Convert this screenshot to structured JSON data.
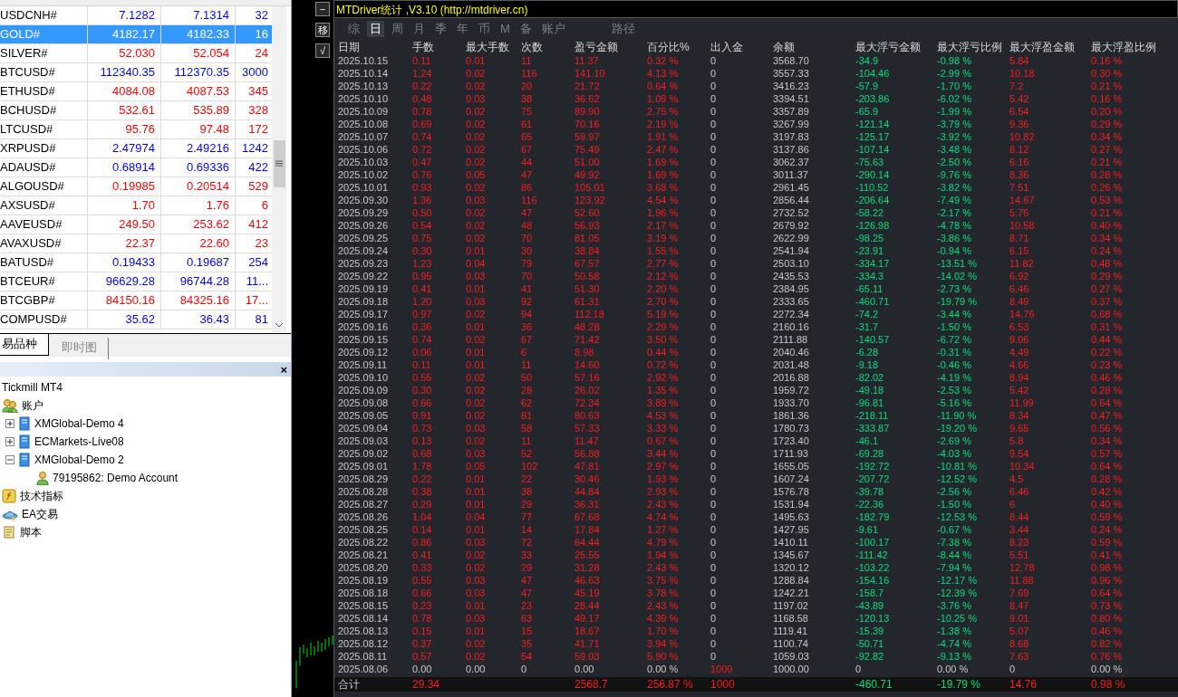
{
  "market_watch": {
    "rows": [
      {
        "symbol": "USDCNH#",
        "bid": "7.1282",
        "ask": "7.1314",
        "spread": "32",
        "color": "#0000ff",
        "selected": false
      },
      {
        "symbol": "GOLD#",
        "bid": "4182.17",
        "ask": "4182.33",
        "spread": "16",
        "selected": true
      },
      {
        "symbol": "SILVER#",
        "bid": "52.030",
        "ask": "52.054",
        "spread": "24",
        "color": "#ff0000",
        "selected": false
      },
      {
        "symbol": "BTCUSD#",
        "bid": "112340.35",
        "ask": "112370.35",
        "spread": "3000",
        "color": "#0000ff",
        "selected": false
      },
      {
        "symbol": "ETHUSD#",
        "bid": "4084.08",
        "ask": "4087.53",
        "spread": "345",
        "color": "#ff0000",
        "selected": false
      },
      {
        "symbol": "BCHUSD#",
        "bid": "532.61",
        "ask": "535.89",
        "spread": "328",
        "color": "#ff0000",
        "selected": false
      },
      {
        "symbol": "LTCUSD#",
        "bid": "95.76",
        "ask": "97.48",
        "spread": "172",
        "color": "#ff0000",
        "selected": false
      },
      {
        "symbol": "XRPUSD#",
        "bid": "2.47974",
        "ask": "2.49216",
        "spread": "1242",
        "color": "#0000ff",
        "selected": false
      },
      {
        "symbol": "ADAUSD#",
        "bid": "0.68914",
        "ask": "0.69336",
        "spread": "422",
        "color": "#0000ff",
        "selected": false
      },
      {
        "symbol": "ALGOUSD#",
        "bid": "0.19985",
        "ask": "0.20514",
        "spread": "529",
        "color": "#ff0000",
        "selected": false
      },
      {
        "symbol": "AXSUSD#",
        "bid": "1.70",
        "ask": "1.76",
        "spread": "6",
        "color": "#ff0000",
        "selected": false
      },
      {
        "symbol": "AAVEUSD#",
        "bid": "249.50",
        "ask": "253.62",
        "spread": "412",
        "color": "#ff0000",
        "selected": false
      },
      {
        "symbol": "AVAXUSD#",
        "bid": "22.37",
        "ask": "22.60",
        "spread": "23",
        "color": "#ff0000",
        "selected": false
      },
      {
        "symbol": "BATUSD#",
        "bid": "0.19433",
        "ask": "0.19687",
        "spread": "254",
        "color": "#0000ff",
        "selected": false
      },
      {
        "symbol": "BTCEUR#",
        "bid": "96629.28",
        "ask": "96744.28",
        "spread": "11...",
        "color": "#0000ff",
        "selected": false
      },
      {
        "symbol": "BTCGBP#",
        "bid": "84150.16",
        "ask": "84325.16",
        "spread": "17...",
        "color": "#ff0000",
        "selected": false
      },
      {
        "symbol": "COMPUSD#",
        "bid": "35.62",
        "ask": "36.43",
        "spread": "81",
        "color": "#0000ff",
        "selected": false
      }
    ],
    "tabs": [
      {
        "label": "易品种",
        "selected": true
      },
      {
        "label": "即时图",
        "selected": false
      }
    ]
  },
  "navigator": {
    "close": "×",
    "tree": [
      {
        "label": "Tickmill MT4",
        "children": [
          {
            "label": "账户",
            "kind": "accounts",
            "children": [
              {
                "label": "XMGlobal-Demo 4",
                "kind": "server",
                "expanded": false
              },
              {
                "label": "ECMarkets-Live08",
                "kind": "server",
                "expanded": false
              },
              {
                "label": "XMGlobal-Demo 2",
                "kind": "server",
                "expanded": true,
                "children": [
                  {
                    "label": "79195862: Demo Account",
                    "kind": "user"
                  }
                ]
              }
            ]
          },
          {
            "label": "技术指标",
            "kind": "indicator"
          },
          {
            "label": "EA交易",
            "kind": "expert"
          },
          {
            "label": "脚本",
            "kind": "script"
          }
        ]
      }
    ]
  },
  "stats": {
    "side_buttons": [
      "−",
      "移",
      "√"
    ],
    "title": "MTDriver统计 ,V3.10 (http://mtdriver.cn)",
    "tabs": [
      {
        "label": "综",
        "selected": false
      },
      {
        "label": "日",
        "selected": true
      },
      {
        "label": "周",
        "selected": false
      },
      {
        "label": "月",
        "selected": false
      },
      {
        "label": "季",
        "selected": false
      },
      {
        "label": "年",
        "selected": false
      },
      {
        "label": "币",
        "selected": false
      },
      {
        "label": "M",
        "selected": false
      },
      {
        "label": "备",
        "selected": false
      },
      {
        "label": "账户",
        "selected": false
      },
      {
        "label": "路径",
        "selected": false
      }
    ],
    "columns": [
      "日期",
      "手数",
      "最大手数",
      "次数",
      "盈亏金额",
      "百分比%",
      "出入金",
      "余额",
      "最大浮亏金额",
      "最大浮亏比例",
      "最大浮盈金额",
      "最大浮盈比例"
    ],
    "rows": [
      {
        "kind": "day",
        "cells": [
          "2025.10.15",
          "0.11",
          "0.01",
          "11",
          "11.37",
          "0.32 %",
          "0",
          "3568.70",
          "-34.9",
          "-0.98 %",
          "5.84",
          "0.16 %"
        ]
      },
      {
        "kind": "day",
        "cells": [
          "2025.10.14",
          "1.24",
          "0.02",
          "116",
          "141.10",
          "4.13 %",
          "0",
          "3557.33",
          "-104.46",
          "-2.99 %",
          "10.18",
          "0.30 %"
        ]
      },
      {
        "kind": "day",
        "cells": [
          "2025.10.13",
          "0.22",
          "0.02",
          "20",
          "21.72",
          "0.64 %",
          "0",
          "3416.23",
          "-57.9",
          "-1.70 %",
          "7.2",
          "0.21 %"
        ]
      },
      {
        "kind": "day",
        "cells": [
          "2025.10.10",
          "0.48",
          "0.03",
          "38",
          "36.62",
          "1.09 %",
          "0",
          "3394.51",
          "-203.86",
          "-6.02 %",
          "5.42",
          "0.16 %"
        ]
      },
      {
        "kind": "day",
        "cells": [
          "2025.10.09",
          "0.78",
          "0.02",
          "75",
          "89.90",
          "2.75 %",
          "0",
          "3357.89",
          "-65.9",
          "-1.99 %",
          "6.54",
          "0.20 %"
        ]
      },
      {
        "kind": "day",
        "cells": [
          "2025.10.08",
          "0.69",
          "0.02",
          "61",
          "70.16",
          "2.19 %",
          "0",
          "3267.99",
          "-121.14",
          "-3.79 %",
          "9.36",
          "0.29 %"
        ]
      },
      {
        "kind": "day",
        "cells": [
          "2025.10.07",
          "0.74",
          "0.02",
          "65",
          "59.97",
          "1.91 %",
          "0",
          "3197.83",
          "-125.17",
          "-3.92 %",
          "10.82",
          "0.34 %"
        ]
      },
      {
        "kind": "day",
        "cells": [
          "2025.10.06",
          "0.72",
          "0.02",
          "67",
          "75.49",
          "2.47 %",
          "0",
          "3137.86",
          "-107.14",
          "-3.48 %",
          "8.12",
          "0.27 %"
        ]
      },
      {
        "kind": "day",
        "cells": [
          "2025.10.03",
          "0.47",
          "0.02",
          "44",
          "51.00",
          "1.69 %",
          "0",
          "3062.37",
          "-75.63",
          "-2.50 %",
          "6.16",
          "0.21 %"
        ]
      },
      {
        "kind": "day",
        "cells": [
          "2025.10.02",
          "0.76",
          "0.05",
          "47",
          "49.92",
          "1.69 %",
          "0",
          "3011.37",
          "-290.14",
          "-9.76 %",
          "8.36",
          "0.28 %"
        ]
      },
      {
        "kind": "day",
        "cells": [
          "2025.10.01",
          "0.93",
          "0.02",
          "86",
          "105.01",
          "3.68 %",
          "0",
          "2961.45",
          "-110.52",
          "-3.82 %",
          "7.51",
          "0.26 %"
        ]
      },
      {
        "kind": "day",
        "cells": [
          "2025.09.30",
          "1.36",
          "0.03",
          "116",
          "123.92",
          "4.54 %",
          "0",
          "2856.44",
          "-206.64",
          "-7.49 %",
          "14.67",
          "0.53 %"
        ]
      },
      {
        "kind": "day",
        "cells": [
          "2025.09.29",
          "0.50",
          "0.02",
          "47",
          "52.60",
          "1.96 %",
          "0",
          "2732.52",
          "-58.22",
          "-2.17 %",
          "5.76",
          "0.21 %"
        ]
      },
      {
        "kind": "day",
        "cells": [
          "2025.09.26",
          "0.54",
          "0.02",
          "48",
          "56.93",
          "2.17 %",
          "0",
          "2679.92",
          "-126.98",
          "-4.78 %",
          "10.58",
          "0.40 %"
        ]
      },
      {
        "kind": "day",
        "cells": [
          "2025.09.25",
          "0.75",
          "0.02",
          "70",
          "81.05",
          "3.19 %",
          "0",
          "2622.99",
          "-98.25",
          "-3.86 %",
          "8.71",
          "0.34 %"
        ]
      },
      {
        "kind": "day",
        "cells": [
          "2025.09.24",
          "0.30",
          "0.01",
          "30",
          "38.84",
          "1.55 %",
          "0",
          "2541.94",
          "-23.91",
          "-0.94 %",
          "6.15",
          "0.24 %"
        ]
      },
      {
        "kind": "day",
        "cells": [
          "2025.09.23",
          "1.23",
          "0.04",
          "79",
          "67.57",
          "2.77 %",
          "0",
          "2503.10",
          "-334.17",
          "-13.51 %",
          "11.82",
          "0.48 %"
        ]
      },
      {
        "kind": "day",
        "cells": [
          "2025.09.22",
          "0.95",
          "0.03",
          "70",
          "50.58",
          "2.12 %",
          "0",
          "2435.53",
          "-334.3",
          "-14.02 %",
          "6.92",
          "0.29 %"
        ]
      },
      {
        "kind": "day",
        "cells": [
          "2025.09.19",
          "0.41",
          "0.01",
          "41",
          "51.30",
          "2.20 %",
          "0",
          "2384.95",
          "-65.11",
          "-2.73 %",
          "6.46",
          "0.27 %"
        ]
      },
      {
        "kind": "day",
        "cells": [
          "2025.09.18",
          "1.20",
          "0.03",
          "92",
          "61.31",
          "2.70 %",
          "0",
          "2333.65",
          "-460.71",
          "-19.79 %",
          "8.49",
          "0.37 %"
        ]
      },
      {
        "kind": "day",
        "cells": [
          "2025.09.17",
          "0.97",
          "0.02",
          "94",
          "112.18",
          "5.19 %",
          "0",
          "2272.34",
          "-74.2",
          "-3.44 %",
          "14.76",
          "0.68 %"
        ]
      },
      {
        "kind": "day",
        "cells": [
          "2025.09.16",
          "0.36",
          "0.01",
          "36",
          "48.28",
          "2.29 %",
          "0",
          "2160.16",
          "-31.7",
          "-1.50 %",
          "6.53",
          "0.31 %"
        ]
      },
      {
        "kind": "day",
        "cells": [
          "2025.09.15",
          "0.74",
          "0.02",
          "67",
          "71.42",
          "3.50 %",
          "0",
          "2111.88",
          "-140.57",
          "-6.72 %",
          "9.06",
          "0.44 %"
        ]
      },
      {
        "kind": "day",
        "cells": [
          "2025.09.12",
          "0.06",
          "0.01",
          "6",
          "8.98",
          "0.44 %",
          "0",
          "2040.46",
          "-6.28",
          "-0.31 %",
          "4.49",
          "0.22 %"
        ]
      },
      {
        "kind": "day",
        "cells": [
          "2025.09.11",
          "0.11",
          "0.01",
          "11",
          "14.60",
          "0.72 %",
          "0",
          "2031.48",
          "-9.18",
          "-0.46 %",
          "4.66",
          "0.23 %"
        ]
      },
      {
        "kind": "day",
        "cells": [
          "2025.09.10",
          "0.55",
          "0.02",
          "50",
          "57.16",
          "2.92 %",
          "0",
          "2016.88",
          "-82.02",
          "-4.19 %",
          "8.94",
          "0.46 %"
        ]
      },
      {
        "kind": "day",
        "cells": [
          "2025.09.09",
          "0.30",
          "0.02",
          "28",
          "26.02",
          "1.35 %",
          "0",
          "1959.72",
          "-49.18",
          "-2.53 %",
          "5.42",
          "0.28 %"
        ]
      },
      {
        "kind": "day",
        "cells": [
          "2025.09.08",
          "0.66",
          "0.02",
          "62",
          "72.34",
          "3.89 %",
          "0",
          "1933.70",
          "-96.81",
          "-5.16 %",
          "11.99",
          "0.64 %"
        ]
      },
      {
        "kind": "day",
        "cells": [
          "2025.09.05",
          "0.91",
          "0.02",
          "81",
          "80.63",
          "4.53 %",
          "0",
          "1861.36",
          "-218.11",
          "-11.90 %",
          "8.34",
          "0.47 %"
        ]
      },
      {
        "kind": "day",
        "cells": [
          "2025.09.04",
          "0.73",
          "0.03",
          "58",
          "57.33",
          "3.33 %",
          "0",
          "1780.73",
          "-333.87",
          "-19.20 %",
          "9.65",
          "0.56 %"
        ]
      },
      {
        "kind": "day",
        "cells": [
          "2025.09.03",
          "0.13",
          "0.02",
          "11",
          "11.47",
          "0.67 %",
          "0",
          "1723.40",
          "-46.1",
          "-2.69 %",
          "5.8",
          "0.34 %"
        ]
      },
      {
        "kind": "day",
        "cells": [
          "2025.09.02",
          "0.68",
          "0.03",
          "52",
          "56.88",
          "3.44 %",
          "0",
          "1711.93",
          "-69.28",
          "-4.03 %",
          "9.54",
          "0.57 %"
        ]
      },
      {
        "kind": "day",
        "cells": [
          "2025.09.01",
          "1.78",
          "0.05",
          "102",
          "47.81",
          "2.97 %",
          "0",
          "1655.05",
          "-192.72",
          "-10.81 %",
          "10.34",
          "0.64 %"
        ]
      },
      {
        "kind": "day",
        "cells": [
          "2025.08.29",
          "0.22",
          "0.01",
          "22",
          "30.46",
          "1.93 %",
          "0",
          "1607.24",
          "-207.72",
          "-12.52 %",
          "4.5",
          "0.28 %"
        ]
      },
      {
        "kind": "day",
        "cells": [
          "2025.08.28",
          "0.38",
          "0.01",
          "38",
          "44.84",
          "2.93 %",
          "0",
          "1576.78",
          "-39.78",
          "-2.56 %",
          "6.46",
          "0.42 %"
        ]
      },
      {
        "kind": "day",
        "cells": [
          "2025.08.27",
          "0.29",
          "0.01",
          "29",
          "36.31",
          "2.43 %",
          "0",
          "1531.94",
          "-22.36",
          "-1.50 %",
          "6",
          "0.40 %"
        ]
      },
      {
        "kind": "day",
        "cells": [
          "2025.08.26",
          "1.04",
          "0.04",
          "77",
          "67.68",
          "4.74 %",
          "0",
          "1495.63",
          "-182.79",
          "-12.53 %",
          "8.44",
          "0.59 %"
        ]
      },
      {
        "kind": "day",
        "cells": [
          "2025.08.25",
          "0.14",
          "0.01",
          "14",
          "17.84",
          "1.27 %",
          "0",
          "1427.95",
          "-9.61",
          "-0.67 %",
          "3.44",
          "0.24 %"
        ]
      },
      {
        "kind": "day",
        "cells": [
          "2025.08.22",
          "0.86",
          "0.03",
          "72",
          "64.44",
          "4.79 %",
          "0",
          "1410.11",
          "-100.17",
          "-7.38 %",
          "8.23",
          "0.59 %"
        ]
      },
      {
        "kind": "day",
        "cells": [
          "2025.08.21",
          "0.41",
          "0.02",
          "33",
          "25.55",
          "1.94 %",
          "0",
          "1345.67",
          "-111.42",
          "-8.44 %",
          "5.51",
          "0.41 %"
        ]
      },
      {
        "kind": "day",
        "cells": [
          "2025.08.20",
          "0.33",
          "0.02",
          "29",
          "31.28",
          "2.43 %",
          "0",
          "1320.12",
          "-103.22",
          "-7.94 %",
          "12.78",
          "0.98 %"
        ]
      },
      {
        "kind": "day",
        "cells": [
          "2025.08.19",
          "0.55",
          "0.03",
          "47",
          "46.63",
          "3.75 %",
          "0",
          "1288.84",
          "-154.16",
          "-12.17 %",
          "11.88",
          "0.96 %"
        ]
      },
      {
        "kind": "day",
        "cells": [
          "2025.08.18",
          "0.66",
          "0.03",
          "47",
          "45.19",
          "3.78 %",
          "0",
          "1242.21",
          "-158.7",
          "-12.39 %",
          "7.69",
          "0.64 %"
        ]
      },
      {
        "kind": "day",
        "cells": [
          "2025.08.15",
          "0.23",
          "0.01",
          "23",
          "28.44",
          "2.43 %",
          "0",
          "1197.02",
          "-43.89",
          "-3.76 %",
          "8.47",
          "0.73 %"
        ]
      },
      {
        "kind": "day",
        "cells": [
          "2025.08.14",
          "0.78",
          "0.03",
          "63",
          "49.17",
          "4.39 %",
          "0",
          "1168.58",
          "-120.13",
          "-10.25 %",
          "9.01",
          "0.80 %"
        ]
      },
      {
        "kind": "day",
        "cells": [
          "2025.08.13",
          "0.15",
          "0.01",
          "15",
          "18.67",
          "1.70 %",
          "0",
          "1119.41",
          "-15.39",
          "-1.38 %",
          "5.07",
          "0.46 %"
        ]
      },
      {
        "kind": "day",
        "cells": [
          "2025.08.12",
          "0.37",
          "0.02",
          "35",
          "41.71",
          "3.94 %",
          "0",
          "1100.74",
          "-50.71",
          "-4.74 %",
          "8.68",
          "0.82 %"
        ]
      },
      {
        "kind": "day",
        "cells": [
          "2025.08.11",
          "0.57",
          "0.02",
          "54",
          "59.03",
          "5.90 %",
          "0",
          "1059.03",
          "-92.82",
          "-9.13 %",
          "7.63",
          "0.76 %"
        ]
      },
      {
        "kind": "deposit",
        "cells": [
          "2025.08.06",
          "0.00",
          "0.00",
          "0",
          "0.00",
          "0.00 %",
          "1000",
          "1000.00",
          "0",
          "0.00 %",
          "0",
          "0.00 %"
        ]
      },
      {
        "kind": "total",
        "cells": [
          "合计",
          "29.34",
          "",
          "",
          "2568.7",
          "256.87 %",
          "1000",
          "",
          "-460.71",
          "-19.79 %",
          "14.76",
          "0.98 %"
        ]
      }
    ]
  }
}
